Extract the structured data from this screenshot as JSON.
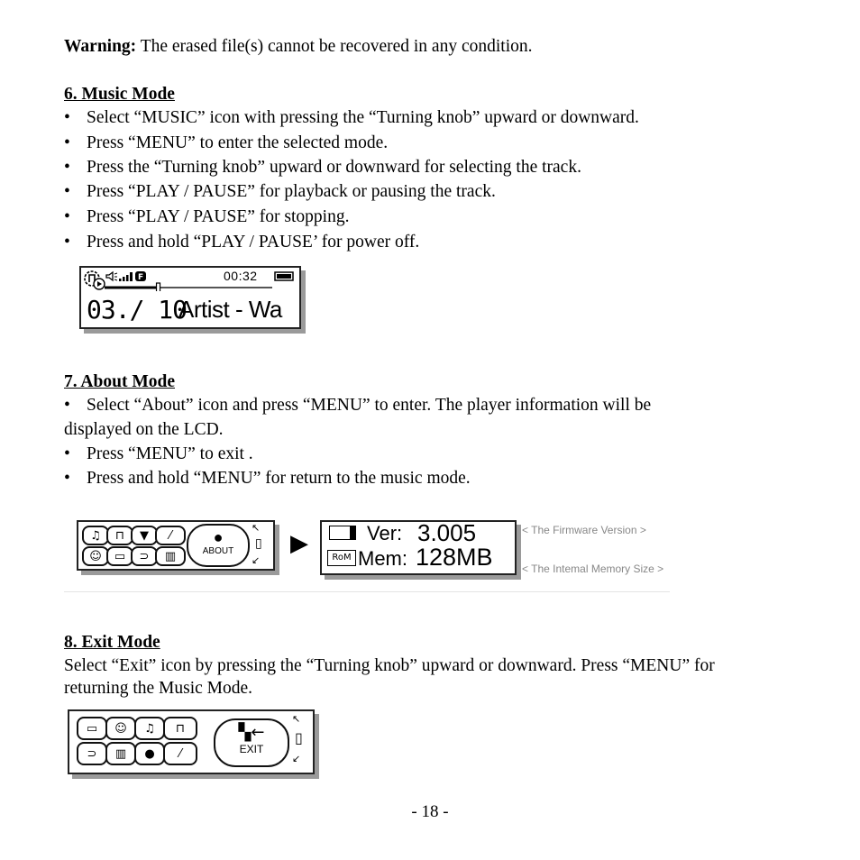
{
  "warning": {
    "label": "Warning:",
    "text": " The erased file(s) cannot be recovered in any condition."
  },
  "music_mode": {
    "heading": "6. Music Mode",
    "bullets": [
      "Select “MUSIC” icon with pressing the “Turning knob” upward or downward.",
      "Press “MENU” to enter the selected mode.",
      "Press the “Turning knob” upward or downward for selecting the track.",
      "Press “PLAY / PAUSE” for playback or pausing the track.",
      "Press “PLAY / PAUSE” for stopping.",
      "Press and hold “PLAY / PAUSE’ for power off."
    ],
    "lcd": {
      "time": "00:32",
      "track": "03./ 10",
      "title": "Artist - Wa",
      "eq_badge": "F",
      "progress": 0.32,
      "icons": [
        "music-note-icon",
        "play-icon",
        "volume-icon",
        "signal-bars-icon",
        "eq-badge-icon",
        "battery-icon"
      ]
    }
  },
  "about_mode": {
    "heading": "7. About Mode",
    "bullet_1_line1": "Select “About” icon and press “MENU” to enter. The player information will be",
    "bullet_1_line2": "displayed on the LCD.",
    "bullets": [
      "Press “MENU” to exit .",
      "Press and hold “MENU” for return to the music mode."
    ],
    "menu_lcd": {
      "selected_label": "ABOUT",
      "icons": [
        "music-icon",
        "folder-icon",
        "voice-icon",
        "mic-icon",
        "face-icon",
        "card-icon",
        "plug-icon",
        "radio-icon",
        "about-icon"
      ]
    },
    "info_lcd": {
      "ver_label": "Ver:",
      "ver_value": "3.005",
      "mem_label": "Mem:",
      "mem_value": "128MB",
      "rom_badge": "RoM"
    },
    "captions": {
      "firmware": "< The Firmware Version >",
      "memory": "< The Intemal Memory Size >"
    }
  },
  "exit_mode": {
    "heading": "8. Exit Mode",
    "text_line1": "Select “Exit” icon by pressing the “Turning knob” upward or downward. Press “MENU” for",
    "text_line2": "returning the Music Mode.",
    "menu_lcd": {
      "selected_label": "EXIT",
      "icons": [
        "card-icon",
        "face-icon",
        "music-icon",
        "folder-icon",
        "plug-icon",
        "radio-icon",
        "about-icon",
        "mic-icon",
        "exit-icon"
      ]
    }
  },
  "footer": {
    "page_number": "- 18 -"
  },
  "symbols": {
    "bullet": "•",
    "arrow_right": "▶",
    "arrow_up_left": "↖",
    "arrow_down_left": "↙"
  }
}
